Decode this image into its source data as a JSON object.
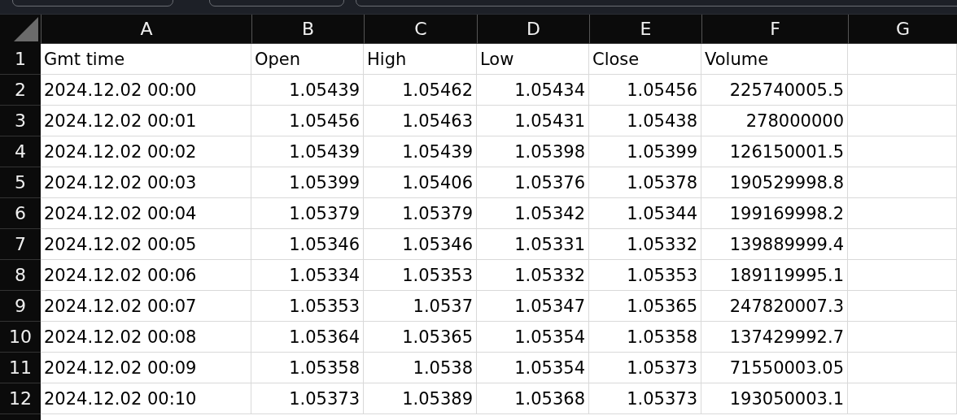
{
  "columns": [
    "A",
    "B",
    "C",
    "D",
    "E",
    "F",
    "G"
  ],
  "rows": [
    {
      "number": "1",
      "cells": [
        "Gmt time",
        "Open",
        "High",
        "Low",
        "Close",
        "Volume"
      ]
    },
    {
      "number": "2",
      "cells": [
        "2024.12.02 00:00",
        "1.05439",
        "1.05462",
        "1.05434",
        "1.05456",
        "225740005.5"
      ]
    },
    {
      "number": "3",
      "cells": [
        "2024.12.02 00:01",
        "1.05456",
        "1.05463",
        "1.05431",
        "1.05438",
        "278000000"
      ]
    },
    {
      "number": "4",
      "cells": [
        "2024.12.02 00:02",
        "1.05439",
        "1.05439",
        "1.05398",
        "1.05399",
        "126150001.5"
      ]
    },
    {
      "number": "5",
      "cells": [
        "2024.12.02 00:03",
        "1.05399",
        "1.05406",
        "1.05376",
        "1.05378",
        "190529998.8"
      ]
    },
    {
      "number": "6",
      "cells": [
        "2024.12.02 00:04",
        "1.05379",
        "1.05379",
        "1.05342",
        "1.05344",
        "199169998.2"
      ]
    },
    {
      "number": "7",
      "cells": [
        "2024.12.02 00:05",
        "1.05346",
        "1.05346",
        "1.05331",
        "1.05332",
        "139889999.4"
      ]
    },
    {
      "number": "8",
      "cells": [
        "2024.12.02 00:06",
        "1.05334",
        "1.05353",
        "1.05332",
        "1.05353",
        "189119995.1"
      ]
    },
    {
      "number": "9",
      "cells": [
        "2024.12.02 00:07",
        "1.05353",
        "1.0537",
        "1.05347",
        "1.05365",
        "247820007.3"
      ]
    },
    {
      "number": "10",
      "cells": [
        "2024.12.02 00:08",
        "1.05364",
        "1.05365",
        "1.05354",
        "1.05358",
        "137429992.7"
      ]
    },
    {
      "number": "11",
      "cells": [
        "2024.12.02 00:09",
        "1.05358",
        "1.0538",
        "1.05354",
        "1.05373",
        "71550003.05"
      ]
    },
    {
      "number": "12",
      "cells": [
        "2024.12.02 00:10",
        "1.05373",
        "1.05389",
        "1.05368",
        "1.05373",
        "193050003.1"
      ]
    }
  ]
}
